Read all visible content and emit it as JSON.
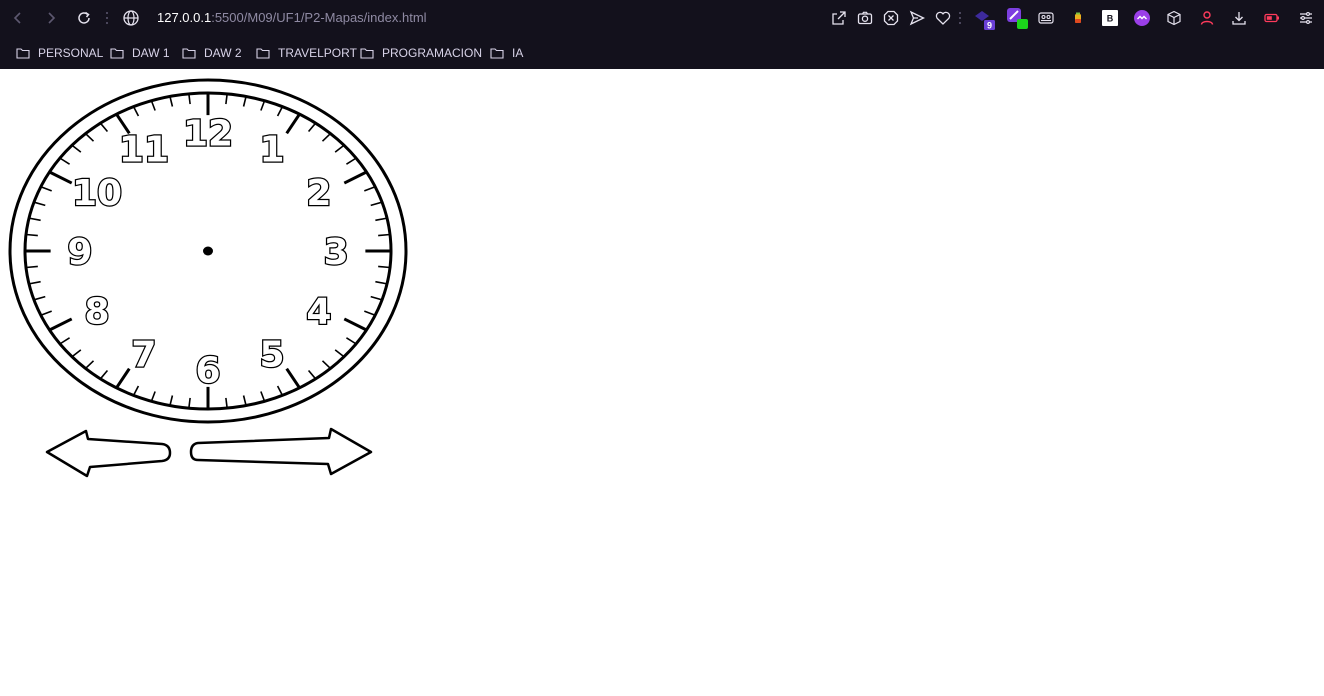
{
  "browser": {
    "url_host": "127.0.0.1",
    "url_rest": ":5500/M09/UF1/P2-Mapas/index.html",
    "nav_icons": [
      "back-icon",
      "forward-icon",
      "reload-icon"
    ],
    "toolbar_icons": [
      "share-icon",
      "camera-icon",
      "adblock-icon",
      "send-icon",
      "heart-icon",
      "extension-icon",
      "extension-icon",
      "extension-icon",
      "extension-icon",
      "extension-icon",
      "extension-icon",
      "box-icon",
      "profile-icon",
      "download-icon",
      "battery-icon",
      "settings-icon"
    ],
    "extension_badge": "9",
    "extension_letter": "B",
    "bookmarks": [
      {
        "label": "PERSONAL"
      },
      {
        "label": "DAW 1"
      },
      {
        "label": "DAW 2"
      },
      {
        "label": "TRAVELPORT"
      },
      {
        "label": "PROGRAMACION"
      },
      {
        "label": "IA"
      }
    ]
  },
  "clock": {
    "numbers": [
      "12",
      "1",
      "2",
      "3",
      "4",
      "5",
      "6",
      "7",
      "8",
      "9",
      "10",
      "11"
    ],
    "has_hands": false
  },
  "controls": {
    "left_arrow": "arrow-left-icon",
    "right_arrow": "arrow-right-icon"
  },
  "colors": {
    "chrome_bg": "#13111c",
    "page_bg": "#ffffff",
    "ink": "#000000"
  }
}
